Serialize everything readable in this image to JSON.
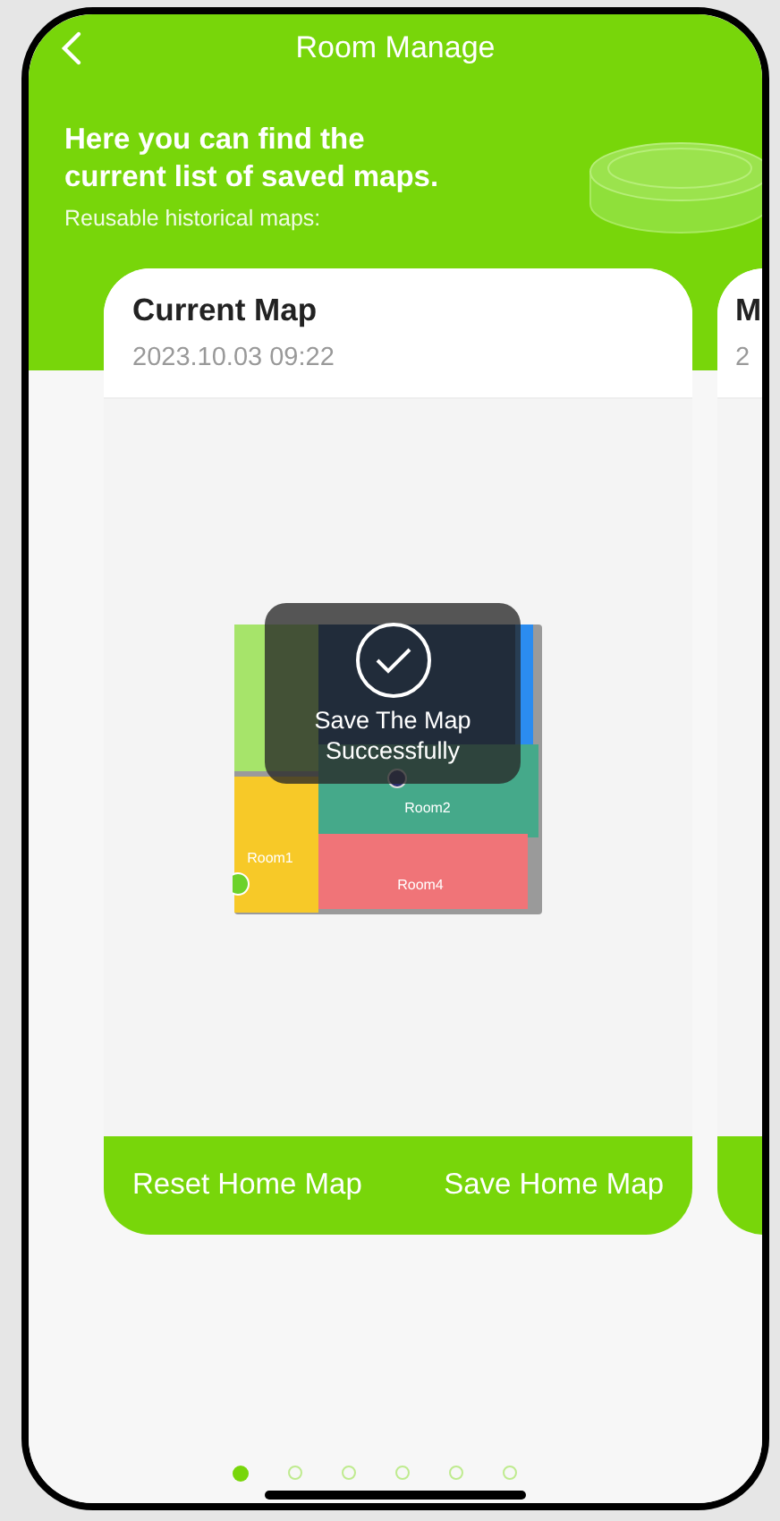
{
  "header": {
    "title": "Room Manage"
  },
  "intro": {
    "heading": "Here you can find the current list of saved maps.",
    "subheading": "Reusable historical maps:"
  },
  "maps": [
    {
      "title": "Current Map",
      "date": "2023.10.03 09:22",
      "room_labels": [
        "Room2",
        "Room1",
        "Room4"
      ],
      "buttons": [
        "Reset Home Map",
        "Save Home Map"
      ]
    },
    {
      "title": "M",
      "date": "2"
    }
  ],
  "toast": {
    "message": "Save The Map Successfully"
  },
  "pager": [
    {
      "selected": true
    },
    {
      "selected": false
    },
    {
      "selected": false
    },
    {
      "selected": false
    },
    {
      "selected": false
    },
    {
      "selected": false
    }
  ]
}
